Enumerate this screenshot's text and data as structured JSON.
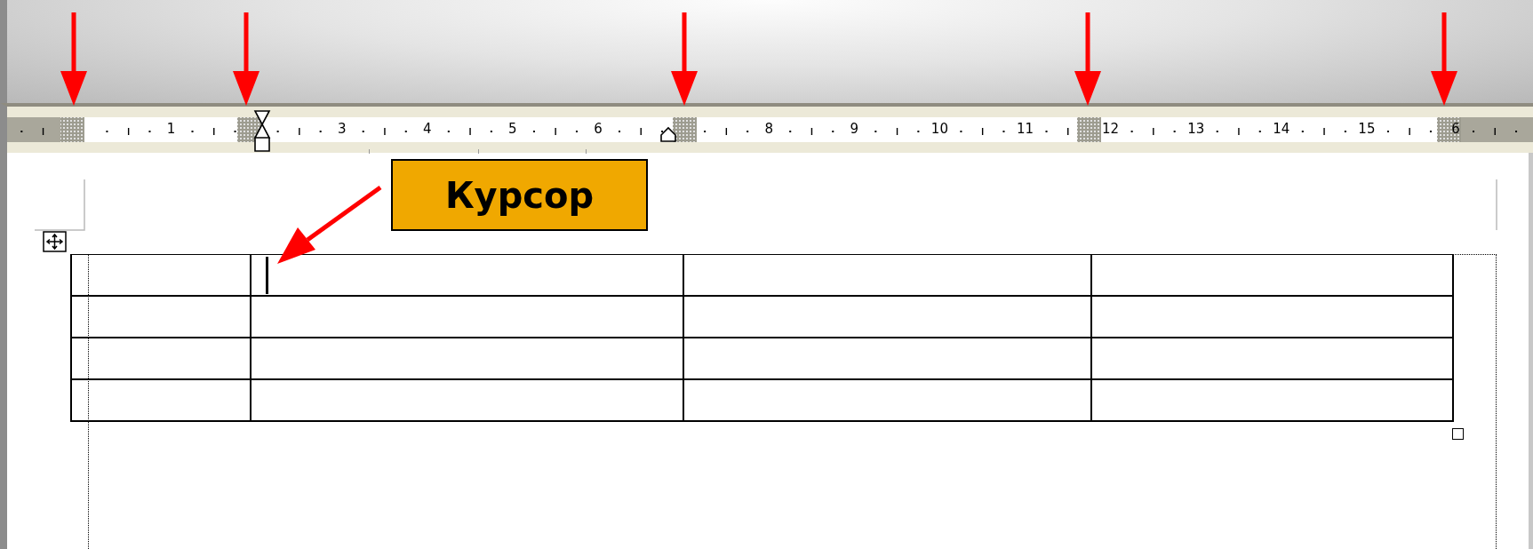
{
  "ruler": {
    "numbers": [
      "1",
      "3",
      "4",
      "5",
      "6",
      "8",
      "9",
      "10",
      "11",
      "12",
      "13",
      "14",
      "15",
      "6"
    ]
  },
  "callout": {
    "text": "Курсор"
  },
  "table": {
    "rows": [
      {
        "cells": [
          {
            "cursor": false
          },
          {
            "cursor": true
          },
          {
            "cursor": false
          },
          {
            "cursor": false
          }
        ]
      },
      {
        "cells": [
          {
            "cursor": false
          },
          {
            "cursor": false
          },
          {
            "cursor": false
          },
          {
            "cursor": false
          }
        ]
      },
      {
        "cells": [
          {
            "cursor": false
          },
          {
            "cursor": false
          },
          {
            "cursor": false
          },
          {
            "cursor": false
          }
        ]
      },
      {
        "cells": [
          {
            "cursor": false
          },
          {
            "cursor": false
          },
          {
            "cursor": false
          },
          {
            "cursor": false
          }
        ]
      }
    ]
  }
}
